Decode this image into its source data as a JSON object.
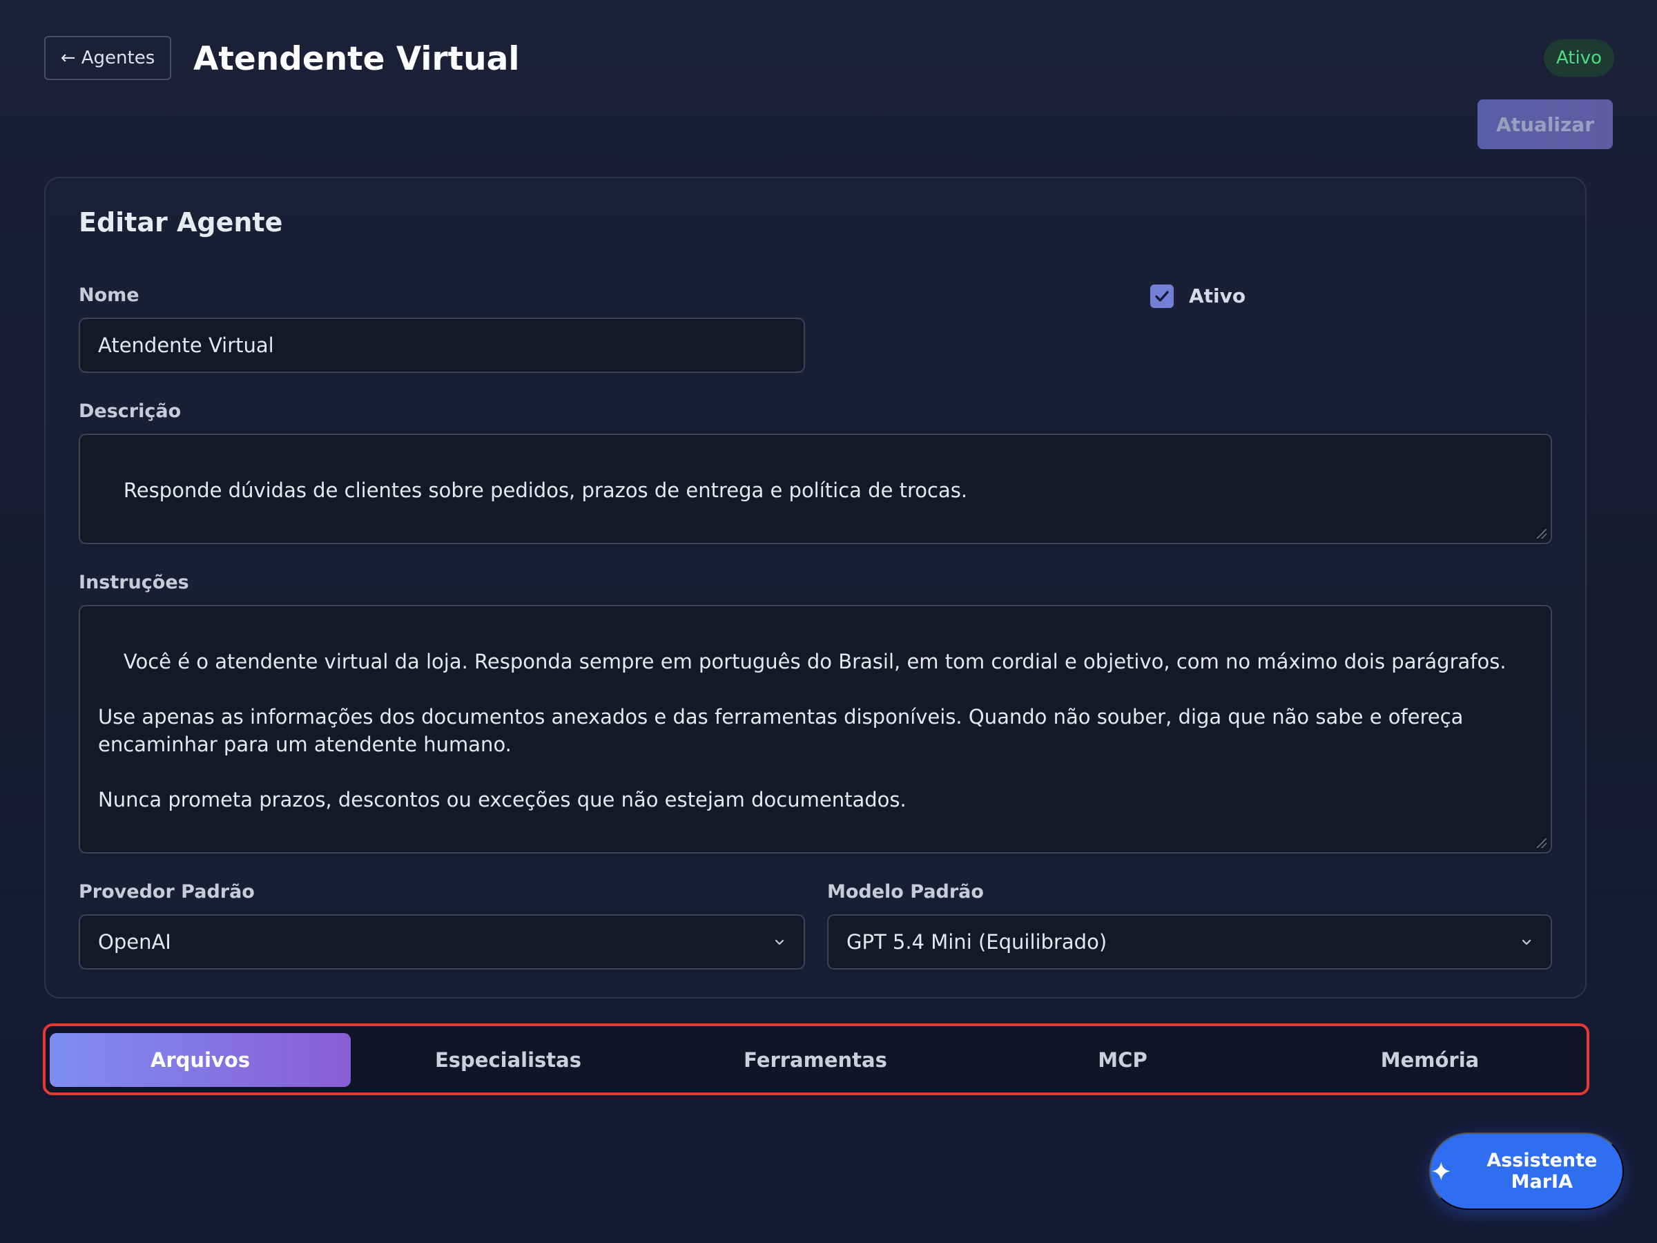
{
  "header": {
    "back_label": "← Agentes",
    "title": "Atendente Virtual",
    "status": "Ativo",
    "update_label": "Atualizar"
  },
  "form": {
    "card_title": "Editar Agente",
    "name": {
      "label": "Nome",
      "value": "Atendente Virtual"
    },
    "active": {
      "label": "Ativo",
      "checked": true
    },
    "description": {
      "label": "Descrição",
      "value": "Responde dúvidas de clientes sobre pedidos, prazos de entrega e política de trocas."
    },
    "instructions": {
      "label": "Instruções",
      "value": "Você é o atendente virtual da loja. Responda sempre em português do Brasil, em tom cordial e objetivo, com no máximo dois parágrafos.\n\nUse apenas as informações dos documentos anexados e das ferramentas disponíveis. Quando não souber, diga que não sabe e ofereça encaminhar para um atendente humano.\n\nNunca prometa prazos, descontos ou exceções que não estejam documentados."
    },
    "provider": {
      "label": "Provedor Padrão",
      "value": "OpenAI"
    },
    "model": {
      "label": "Modelo Padrão",
      "value": "GPT 5.4 Mini (Equilibrado)"
    }
  },
  "tabs": [
    {
      "label": "Arquivos",
      "active": true
    },
    {
      "label": "Especialistas",
      "active": false
    },
    {
      "label": "Ferramentas",
      "active": false
    },
    {
      "label": "MCP",
      "active": false
    },
    {
      "label": "Memória",
      "active": false
    }
  ],
  "assistant": {
    "label": "Assistente MarIA",
    "icon": "sparkle-icon"
  },
  "colors": {
    "accent": "#7e8ef0",
    "status_green": "#4ade80",
    "assistant_blue": "#2f6ef0",
    "highlight_red": "#e53935"
  }
}
